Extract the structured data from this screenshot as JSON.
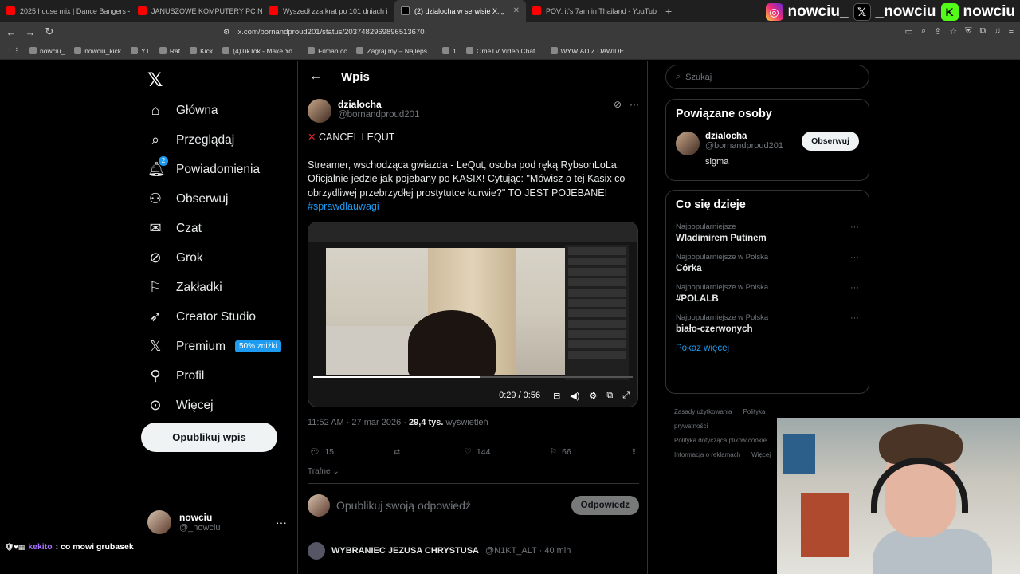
{
  "browser": {
    "tabs": [
      {
        "title": "2025 house mix | Dance Bangers - Yo",
        "icon": "youtube-icon",
        "active": false
      },
      {
        "title": "JANUSZOWE KOMPUTERY PC Niemie",
        "icon": "youtube-icon",
        "active": false
      },
      {
        "title": "Wyszedł zza krat po 101 dniach i",
        "icon": "youtube-icon",
        "active": false
      },
      {
        "title": "(2) dzialocha w serwisie X: „",
        "icon": "x-icon",
        "active": true
      },
      {
        "title": "POV: it's 7am in Thailand - YouTube",
        "icon": "youtube-icon",
        "active": false
      }
    ],
    "url": "x.com/bornandproud201/status/2037482969896513670",
    "bookmarks": [
      "nowciu_",
      "nowciu_kick",
      "YT",
      "Rat",
      "Kick",
      "(4)TikTok - Make Yo...",
      "Filman.cc",
      "Zagraj.my – Najleps...",
      "1",
      "OmeTV Video Chat...",
      "WYWIAD Z DAWIDE..."
    ]
  },
  "stream_overlay": {
    "handles": [
      "nowciu_",
      "_nowciu",
      "nowciu"
    ],
    "chat_user": "kekito",
    "chat_message": ": co mowi grubasek"
  },
  "sidebar": {
    "items": [
      {
        "label": "Główna",
        "icon": "home-icon"
      },
      {
        "label": "Przeglądaj",
        "icon": "search-icon"
      },
      {
        "label": "Powiadomienia",
        "icon": "bell-icon",
        "badge": "2"
      },
      {
        "label": "Obserwuj",
        "icon": "person-add-icon"
      },
      {
        "label": "Czat",
        "icon": "mail-icon"
      },
      {
        "label": "Grok",
        "icon": "grok-icon"
      },
      {
        "label": "Zakładki",
        "icon": "bookmark-icon"
      },
      {
        "label": "Creator Studio",
        "icon": "rocket-icon"
      },
      {
        "label": "Premium",
        "icon": "x-icon",
        "promo": "50% zniżki"
      },
      {
        "label": "Profil",
        "icon": "person-icon"
      },
      {
        "label": "Więcej",
        "icon": "more-circle-icon"
      }
    ],
    "post_button": "Opublikuj wpis",
    "account": {
      "name": "nowciu",
      "handle": "@_nowciu"
    }
  },
  "main": {
    "header_title": "Wpis",
    "author": {
      "name": "dzialocha",
      "handle": "@bornandproud201"
    },
    "text_title": "CANCEL LEQUT",
    "text_body": "Streamer, wschodząca gwiazda - LeQut, osoba pod ręką RybsonLoLa. Oficjalnie jedzie jak pojebany po KASIX! Cytując: \"Mówisz o tej Kasix co obrzydliwej przebrzydłej prostytutce kurwie?\" TO JEST POJEBANE!",
    "hashtag": "#sprawdlauwagi",
    "video": {
      "time": "0:29 / 0:56",
      "progress": 0.52
    },
    "meta_time": "11:52 AM · 27 mar 2026",
    "meta_views_count": "29,4 tys.",
    "meta_views_label": "wyświetleń",
    "stats": {
      "replies": "15",
      "retweets": "",
      "likes": "144",
      "bookmarks": "66"
    },
    "sort_label": "Trafne",
    "reply_placeholder": "Opublikuj swoją odpowiedź",
    "reply_button": "Odpowiedz",
    "next_reply": {
      "name": "WYBRANIEC JEZUSA CHRYSTUSA",
      "handle": "@N1KT_ALT · 40 min"
    }
  },
  "right": {
    "search_placeholder": "Szukaj",
    "related_title": "Powiązane osoby",
    "related_person": {
      "name": "dzialocha",
      "handle": "@bornandproud201",
      "bio": "sigma",
      "follow": "Obserwuj"
    },
    "trends_title": "Co się dzieje",
    "trends": [
      {
        "category": "Najpopularniejsze",
        "name": "Wladimirem Putinem"
      },
      {
        "category": "Najpopularniejsze w Polska",
        "name": "Córka"
      },
      {
        "category": "Najpopularniejsze w Polska",
        "name": "#POLALB"
      },
      {
        "category": "Najpopularniejsze w Polska",
        "name": "biało-czerwonych"
      }
    ],
    "show_more": "Pokaż więcej",
    "footer": [
      "Zasady użytkowania",
      "Polityka prywatności",
      "Polityka dotycząca plików cookie",
      "Informacja o reklamach",
      "Więcej"
    ]
  }
}
